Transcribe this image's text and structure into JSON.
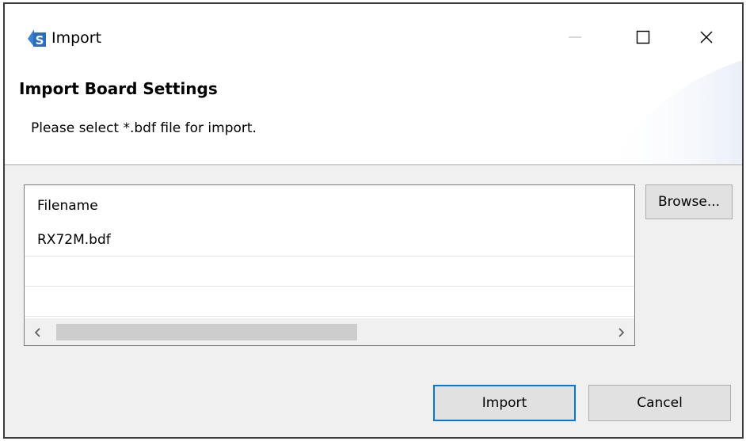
{
  "window": {
    "title": "Import",
    "app_icon": "e2-studio-icon"
  },
  "banner": {
    "title": "Import Board Settings",
    "description": "Please select *.bdf file for import."
  },
  "file_list": {
    "column_header": "Filename",
    "rows": [
      "RX72M.bdf",
      "",
      ""
    ]
  },
  "buttons": {
    "browse": "Browse...",
    "import": "Import",
    "cancel": "Cancel"
  },
  "colors": {
    "default_button_border": "#0078d7",
    "app_icon_blue": "#2a6ebb"
  }
}
